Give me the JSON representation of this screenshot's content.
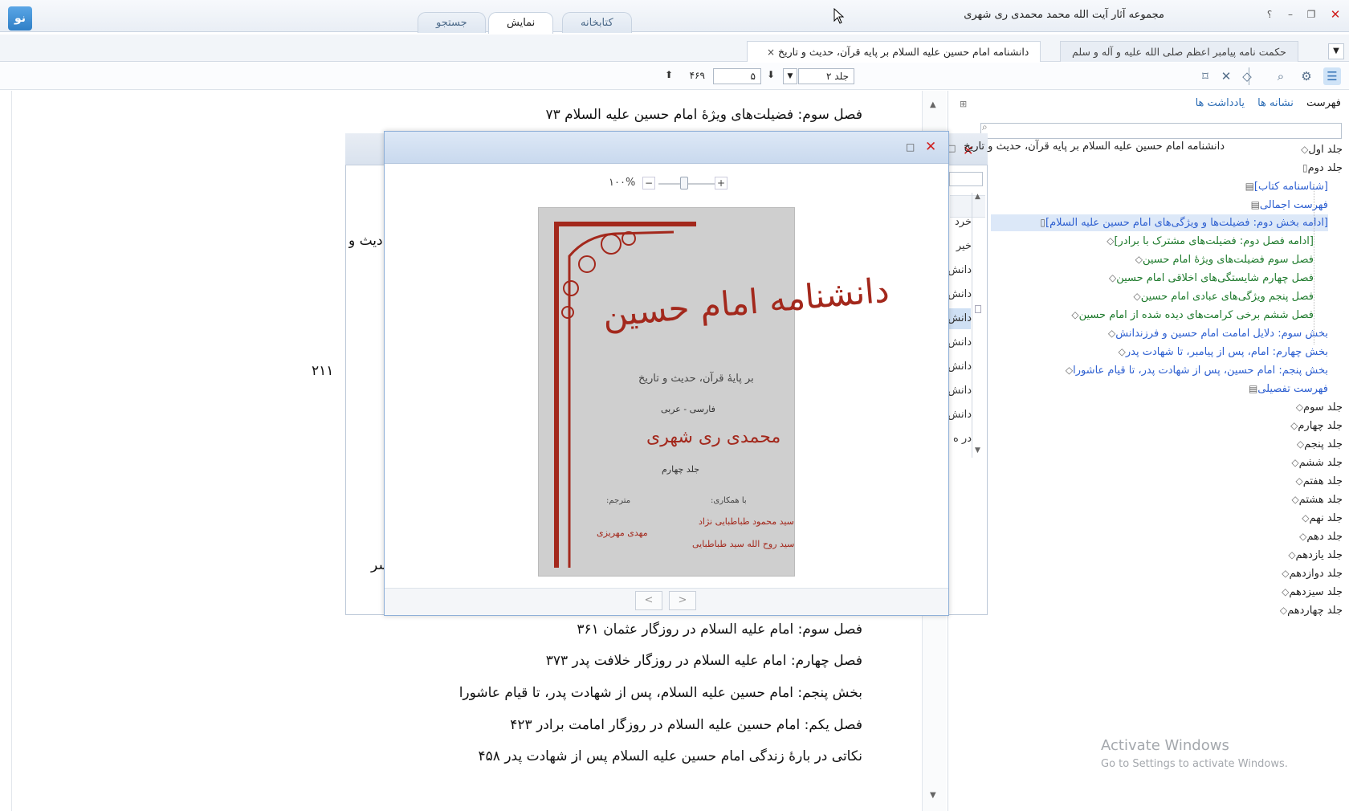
{
  "window": {
    "title": "مجموعه آثار آیت الله محمد محمدی ری شهری",
    "logo_text": "نو",
    "btn_help": "؟",
    "btn_min": "–",
    "btn_max": "❐",
    "btn_close": "✕"
  },
  "mode_tabs": [
    "کتابخانه",
    "نمایش",
    "جستجو"
  ],
  "doc_tabs": {
    "active": "دانشنامه امام حسین علیه السلام بر پایه قرآن، حدیث و تاریخ",
    "other": "حکمت نامه پیامبر اعظم صلی الله علیه و آله و سلم",
    "close_glyph": "×",
    "dropdown_glyph": "▼"
  },
  "toolbar": {
    "volume": "جلد ۲",
    "page": "۵",
    "total": "۴۶۹",
    "down_glyph": "▼",
    "arrow_down": "⬇",
    "arrow_up": "⬆"
  },
  "sidebar": {
    "tabs": {
      "toc": "فهرست",
      "bookmarks": "نشانه ها",
      "notes": "یادداشت ها"
    },
    "tree": [
      "جلد اول",
      "جلد دوم",
      "[شناسنامه کتاب]",
      "فهرست اجمالی",
      "[ادامه بخش دوم: فضیلت‌ها و ویژگی‌های امام حسین علیه السلام]",
      "[ادامه فصل دوم: فضیلت‌های مشترک با برادر]",
      "فصل سوم فضیلت‌های ویژهٔ امام حسین",
      "فصل چهارم شایستگی‌های اخلاقی امام حسین",
      "فصل پنجم ویژگی‌های عبادی امام حسین",
      "فصل ششم برخی کرامت‌های دیده شده از امام حسین",
      "بخش سوم: دلایل امامت امام حسین و فرزندانش",
      "بخش چهارم: امام، پس از پیامبر، تا شهادت پدر",
      "بخش پنجم: امام حسین، پس از شهادت پدر، تا قیام عاشورا",
      "فهرست تفصیلی",
      "جلد سوم",
      "جلد چهارم",
      "جلد پنجم",
      "جلد ششم",
      "جلد هفتم",
      "جلد هشتم",
      "جلد نهم",
      "جلد دهم",
      "جلد یازدهم",
      "جلد دوازدهم",
      "جلد سیزدهم",
      "جلد چهاردهم"
    ]
  },
  "reader": {
    "lines_top": [
      "فصل سوم: فضیلت‌های ویژهٔ امام حسین علیه السلام ۷۳"
    ],
    "side_number": "۲۱۱",
    "lines_bottom": [
      "فصل سوم: امام علیه السلام در روزگار عثمان ۳۶۱",
      "فصل چهارم: امام علیه السلام در روزگار خلافت پدر ۳۷۳",
      "بخش پنجم: امام حسین علیه السلام، پس از شهادت پدر، تا قیام عاشورا",
      "فصل یکم: امام حسین علیه السلام در روزگار امامت برادر ۴۲۳",
      "نکاتی در بارهٔ زندگی امام حسین علیه السلام پس از شهادت پدر ۴۵۸"
    ],
    "up_glyph": "▲",
    "down_glyph": "▼"
  },
  "bg_dialog": {
    "close": "✕",
    "peek_text": "دیث و",
    "peek_text2": "سر",
    "items": [
      "خرد",
      "خیر",
      "دانش",
      "دانش",
      "دانش",
      "دانش",
      "دانش",
      "دانش",
      "دانش",
      "در ه"
    ]
  },
  "cover_dialog": {
    "title": "دانشنامه امام حسین علیه السلام بر پایه قرآن، حدیث و تاریخ",
    "max": "□",
    "close": "✕",
    "zoom": "۱۰۰%",
    "minus": "−",
    "plus": "+",
    "prev": "<",
    "next": ">"
  },
  "cover": {
    "title": "دانشنامه امام حسین",
    "subtitle": "بر پایهٔ قرآن، حدیث و تاریخ",
    "lang": "فارسی - عربی",
    "author": "محمدی ری شهری",
    "volume": "جلد چهارم",
    "coop_label": "با همکاری:",
    "translator_label": "مترجم:",
    "name1": "سید محمود طباطبایی نژاد",
    "name2": "سید روح الله سید طباطبایی",
    "name3": "مهدی مهریزی"
  },
  "watermark": {
    "line1": "Activate Windows",
    "line2": "Go to Settings to activate Windows."
  },
  "colors": {
    "accent": "#2d6db5",
    "tree_blue": "#2d5fd0",
    "tree_green": "#1e7a2c",
    "cover_red": "#a3281c",
    "close_red": "#d02020"
  }
}
